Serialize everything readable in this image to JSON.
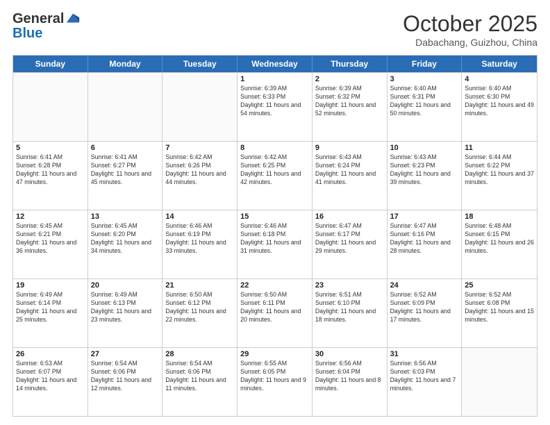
{
  "header": {
    "logo": {
      "general": "General",
      "blue": "Blue"
    },
    "month": "October 2025",
    "location": "Dabachang, Guizhou, China"
  },
  "weekdays": [
    "Sunday",
    "Monday",
    "Tuesday",
    "Wednesday",
    "Thursday",
    "Friday",
    "Saturday"
  ],
  "rows": [
    [
      {
        "day": "",
        "sunrise": "",
        "sunset": "",
        "daylight": "",
        "empty": true
      },
      {
        "day": "",
        "sunrise": "",
        "sunset": "",
        "daylight": "",
        "empty": true
      },
      {
        "day": "",
        "sunrise": "",
        "sunset": "",
        "daylight": "",
        "empty": true
      },
      {
        "day": "1",
        "sunrise": "Sunrise: 6:39 AM",
        "sunset": "Sunset: 6:33 PM",
        "daylight": "Daylight: 11 hours and 54 minutes."
      },
      {
        "day": "2",
        "sunrise": "Sunrise: 6:39 AM",
        "sunset": "Sunset: 6:32 PM",
        "daylight": "Daylight: 11 hours and 52 minutes."
      },
      {
        "day": "3",
        "sunrise": "Sunrise: 6:40 AM",
        "sunset": "Sunset: 6:31 PM",
        "daylight": "Daylight: 11 hours and 50 minutes."
      },
      {
        "day": "4",
        "sunrise": "Sunrise: 6:40 AM",
        "sunset": "Sunset: 6:30 PM",
        "daylight": "Daylight: 11 hours and 49 minutes."
      }
    ],
    [
      {
        "day": "5",
        "sunrise": "Sunrise: 6:41 AM",
        "sunset": "Sunset: 6:28 PM",
        "daylight": "Daylight: 11 hours and 47 minutes."
      },
      {
        "day": "6",
        "sunrise": "Sunrise: 6:41 AM",
        "sunset": "Sunset: 6:27 PM",
        "daylight": "Daylight: 11 hours and 45 minutes."
      },
      {
        "day": "7",
        "sunrise": "Sunrise: 6:42 AM",
        "sunset": "Sunset: 6:26 PM",
        "daylight": "Daylight: 11 hours and 44 minutes."
      },
      {
        "day": "8",
        "sunrise": "Sunrise: 6:42 AM",
        "sunset": "Sunset: 6:25 PM",
        "daylight": "Daylight: 11 hours and 42 minutes."
      },
      {
        "day": "9",
        "sunrise": "Sunrise: 6:43 AM",
        "sunset": "Sunset: 6:24 PM",
        "daylight": "Daylight: 11 hours and 41 minutes."
      },
      {
        "day": "10",
        "sunrise": "Sunrise: 6:43 AM",
        "sunset": "Sunset: 6:23 PM",
        "daylight": "Daylight: 11 hours and 39 minutes."
      },
      {
        "day": "11",
        "sunrise": "Sunrise: 6:44 AM",
        "sunset": "Sunset: 6:22 PM",
        "daylight": "Daylight: 11 hours and 37 minutes."
      }
    ],
    [
      {
        "day": "12",
        "sunrise": "Sunrise: 6:45 AM",
        "sunset": "Sunset: 6:21 PM",
        "daylight": "Daylight: 11 hours and 36 minutes."
      },
      {
        "day": "13",
        "sunrise": "Sunrise: 6:45 AM",
        "sunset": "Sunset: 6:20 PM",
        "daylight": "Daylight: 11 hours and 34 minutes."
      },
      {
        "day": "14",
        "sunrise": "Sunrise: 6:46 AM",
        "sunset": "Sunset: 6:19 PM",
        "daylight": "Daylight: 11 hours and 33 minutes."
      },
      {
        "day": "15",
        "sunrise": "Sunrise: 6:46 AM",
        "sunset": "Sunset: 6:18 PM",
        "daylight": "Daylight: 11 hours and 31 minutes."
      },
      {
        "day": "16",
        "sunrise": "Sunrise: 6:47 AM",
        "sunset": "Sunset: 6:17 PM",
        "daylight": "Daylight: 11 hours and 29 minutes."
      },
      {
        "day": "17",
        "sunrise": "Sunrise: 6:47 AM",
        "sunset": "Sunset: 6:16 PM",
        "daylight": "Daylight: 11 hours and 28 minutes."
      },
      {
        "day": "18",
        "sunrise": "Sunrise: 6:48 AM",
        "sunset": "Sunset: 6:15 PM",
        "daylight": "Daylight: 11 hours and 26 minutes."
      }
    ],
    [
      {
        "day": "19",
        "sunrise": "Sunrise: 6:49 AM",
        "sunset": "Sunset: 6:14 PM",
        "daylight": "Daylight: 11 hours and 25 minutes."
      },
      {
        "day": "20",
        "sunrise": "Sunrise: 6:49 AM",
        "sunset": "Sunset: 6:13 PM",
        "daylight": "Daylight: 11 hours and 23 minutes."
      },
      {
        "day": "21",
        "sunrise": "Sunrise: 6:50 AM",
        "sunset": "Sunset: 6:12 PM",
        "daylight": "Daylight: 11 hours and 22 minutes."
      },
      {
        "day": "22",
        "sunrise": "Sunrise: 6:50 AM",
        "sunset": "Sunset: 6:11 PM",
        "daylight": "Daylight: 11 hours and 20 minutes."
      },
      {
        "day": "23",
        "sunrise": "Sunrise: 6:51 AM",
        "sunset": "Sunset: 6:10 PM",
        "daylight": "Daylight: 11 hours and 18 minutes."
      },
      {
        "day": "24",
        "sunrise": "Sunrise: 6:52 AM",
        "sunset": "Sunset: 6:09 PM",
        "daylight": "Daylight: 11 hours and 17 minutes."
      },
      {
        "day": "25",
        "sunrise": "Sunrise: 6:52 AM",
        "sunset": "Sunset: 6:08 PM",
        "daylight": "Daylight: 11 hours and 15 minutes."
      }
    ],
    [
      {
        "day": "26",
        "sunrise": "Sunrise: 6:53 AM",
        "sunset": "Sunset: 6:07 PM",
        "daylight": "Daylight: 11 hours and 14 minutes."
      },
      {
        "day": "27",
        "sunrise": "Sunrise: 6:54 AM",
        "sunset": "Sunset: 6:06 PM",
        "daylight": "Daylight: 11 hours and 12 minutes."
      },
      {
        "day": "28",
        "sunrise": "Sunrise: 6:54 AM",
        "sunset": "Sunset: 6:06 PM",
        "daylight": "Daylight: 11 hours and 11 minutes."
      },
      {
        "day": "29",
        "sunrise": "Sunrise: 6:55 AM",
        "sunset": "Sunset: 6:05 PM",
        "daylight": "Daylight: 11 hours and 9 minutes."
      },
      {
        "day": "30",
        "sunrise": "Sunrise: 6:56 AM",
        "sunset": "Sunset: 6:04 PM",
        "daylight": "Daylight: 11 hours and 8 minutes."
      },
      {
        "day": "31",
        "sunrise": "Sunrise: 6:56 AM",
        "sunset": "Sunset: 6:03 PM",
        "daylight": "Daylight: 11 hours and 7 minutes."
      },
      {
        "day": "",
        "sunrise": "",
        "sunset": "",
        "daylight": "",
        "empty": true
      }
    ]
  ]
}
